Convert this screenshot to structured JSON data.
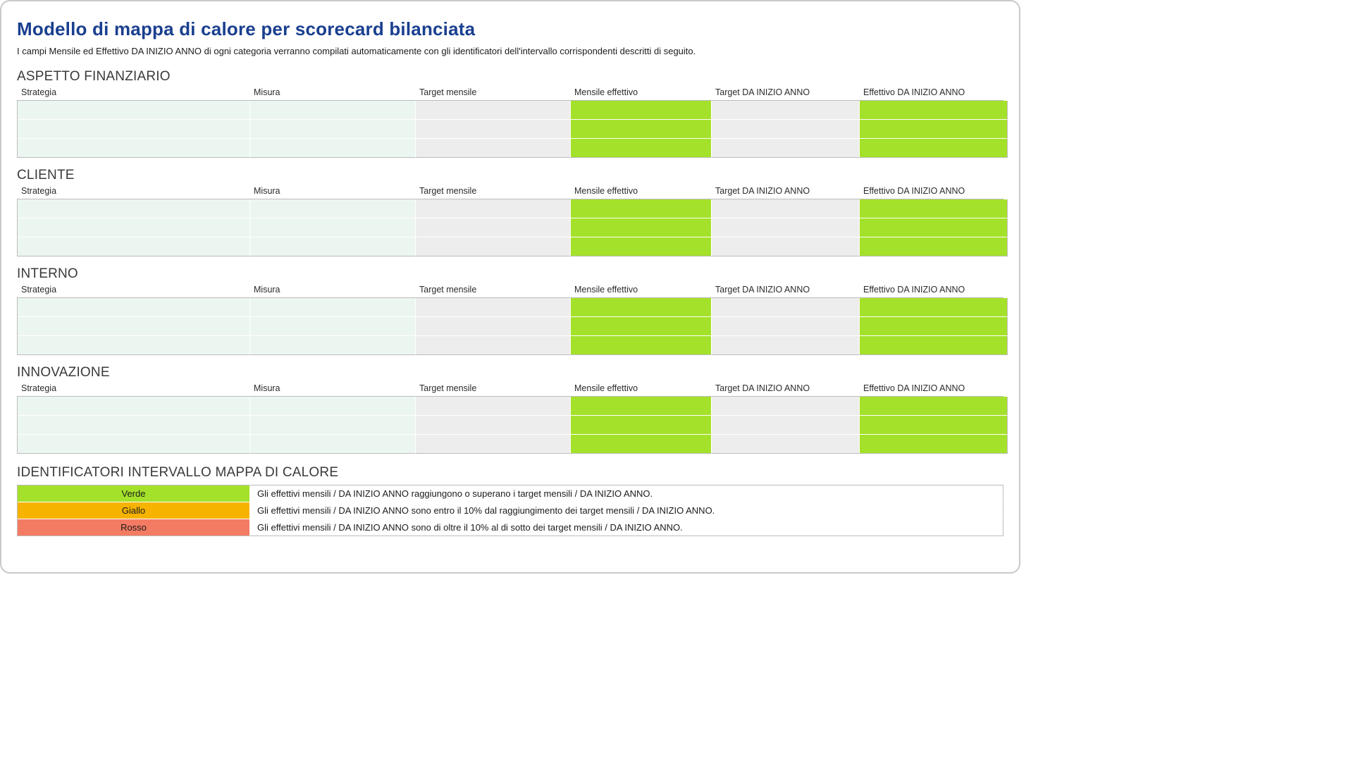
{
  "title": "Modello di mappa di calore per scorecard bilanciata",
  "subtitle": "I campi Mensile ed Effettivo DA INIZIO ANNO di ogni categoria verranno compilati automaticamente con gli identificatori dell'intervallo corrispondenti descritti di seguito.",
  "columns": {
    "strategia": "Strategia",
    "misura": "Misura",
    "target_mensile": "Target mensile",
    "mensile_effettivo": "Mensile effettivo",
    "target_ytd": "Target DA INIZIO ANNO",
    "effettivo_ytd": "Effettivo DA INIZIO ANNO"
  },
  "sections": {
    "finanziario": {
      "heading": "ASPETTO FINANZIARIO"
    },
    "cliente": {
      "heading": "CLIENTE"
    },
    "interno": {
      "heading": "INTERNO"
    },
    "innovazione": {
      "heading": "INNOVAZIONE"
    }
  },
  "legend": {
    "heading": "IDENTIFICATORI INTERVALLO MAPPA DI CALORE",
    "rows": [
      {
        "label": "Verde",
        "color": "green",
        "desc": "Gli effettivi mensili / DA INIZIO ANNO raggiungono o superano i target mensili / DA INIZIO ANNO."
      },
      {
        "label": "Giallo",
        "color": "yellow",
        "desc": "Gli effettivi mensili / DA INIZIO ANNO sono entro il 10% dal raggiungimento dei target mensili / DA INIZIO ANNO."
      },
      {
        "label": "Rosso",
        "color": "red",
        "desc": "Gli effettivi mensili / DA INIZIO ANNO sono di oltre il 10% al di sotto dei target mensili / DA INIZIO ANNO."
      }
    ]
  },
  "chart_data": {
    "type": "heatmap",
    "column_kinds": [
      "input",
      "input",
      "input",
      "status",
      "input",
      "status"
    ],
    "status_color_default": "green",
    "sections": [
      "ASPETTO FINANZIARIO",
      "CLIENTE",
      "INTERNO",
      "INNOVAZIONE"
    ],
    "rows_per_section": 3,
    "legend_thresholds": {
      "green": "actual >= target",
      "yellow": "target * 0.90 <= actual < target",
      "red": "actual < target * 0.90"
    }
  }
}
